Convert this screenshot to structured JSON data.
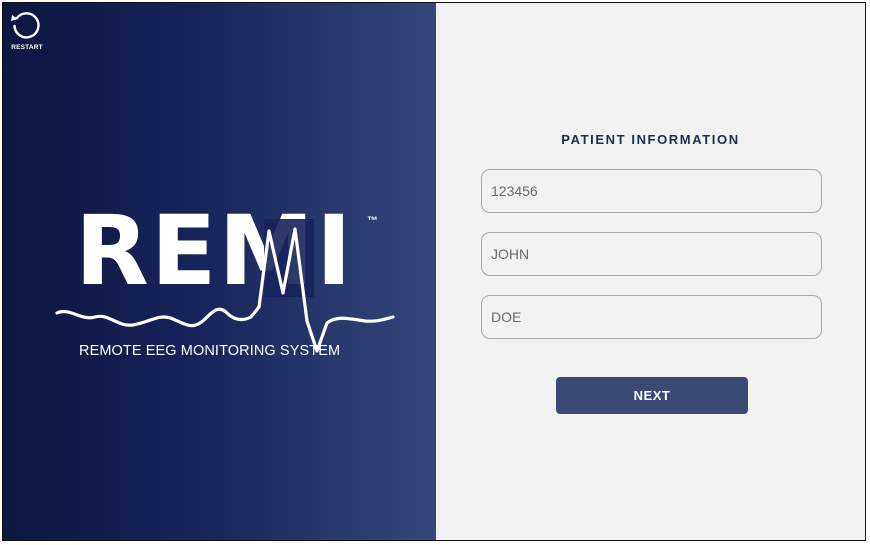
{
  "restart": {
    "label": "RESTART",
    "icon": "restart-icon"
  },
  "brand": {
    "name": "REMI",
    "trademark": "™",
    "subtitle": "REMOTE EEG MONITORING SYSTEM"
  },
  "form": {
    "title": "PATIENT INFORMATION",
    "fields": [
      {
        "value": "123456"
      },
      {
        "value": "JOHN"
      },
      {
        "value": "DOE"
      }
    ],
    "next_label": "NEXT"
  },
  "colors": {
    "left_gradient_start": "#0d1640",
    "left_gradient_end": "#34487a",
    "right_background": "#f2f2f2",
    "accent_button": "#3a4a74",
    "title_text": "#1c2c54"
  }
}
